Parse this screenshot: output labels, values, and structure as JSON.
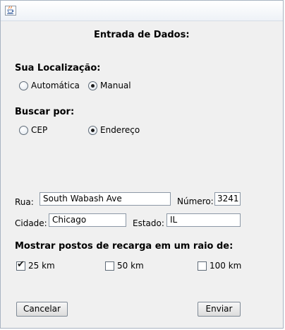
{
  "form": {
    "title": "Entrada de Dados:"
  },
  "location": {
    "heading": "Sua Localização:",
    "options": [
      {
        "label": "Automática",
        "selected": false
      },
      {
        "label": "Manual",
        "selected": true
      }
    ]
  },
  "search_by": {
    "heading": "Buscar por:",
    "options": [
      {
        "label": "CEP",
        "selected": false
      },
      {
        "label": "Endereço",
        "selected": true
      }
    ]
  },
  "address": {
    "street_label": "Rua:",
    "street_value": "South Wabash Ave",
    "number_label": "Número:",
    "number_value": "3241",
    "city_label": "Cidade:",
    "city_value": "Chicago",
    "state_label": "Estado:",
    "state_value": "IL"
  },
  "radius": {
    "heading": "Mostrar postos de recarga em um raio de:",
    "options": [
      {
        "label": "25 km",
        "checked": true
      },
      {
        "label": "50 km",
        "checked": false
      },
      {
        "label": "100 km",
        "checked": false
      }
    ]
  },
  "buttons": {
    "cancel_label": "Cancelar",
    "submit_label": "Enviar"
  },
  "icons": {
    "window_icon": "java-cup-icon"
  }
}
